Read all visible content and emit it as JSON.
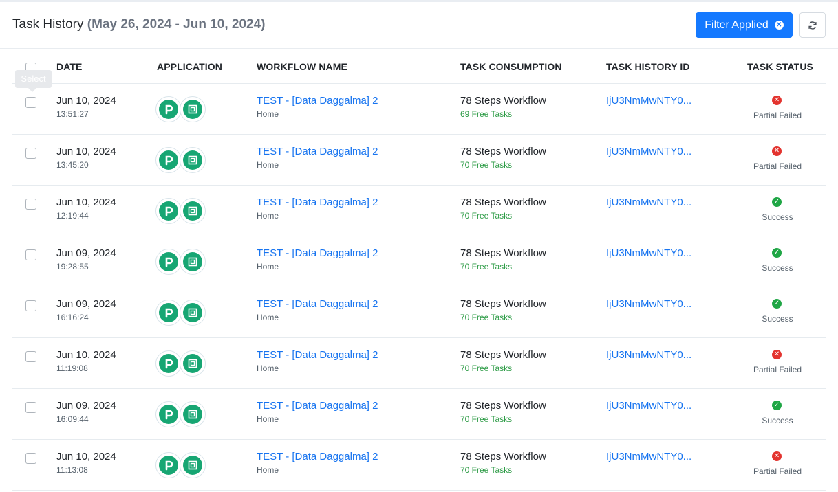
{
  "header": {
    "title": "Task History",
    "date_range": "(May 26, 2024 - Jun 10, 2024)",
    "filter_button": "Filter Applied",
    "filter_clear_icon": "close-circle-icon",
    "refresh_icon": "refresh-icon"
  },
  "table": {
    "select_tooltip": "Select",
    "columns": {
      "date": "DATE",
      "application": "APPLICATION",
      "workflow_name": "WORKFLOW NAME",
      "task_consumption": "TASK CONSUMPTION",
      "task_history_id": "TASK HISTORY ID",
      "task_status": "TASK STATUS"
    },
    "app_icons": [
      "pabbly-p-icon",
      "app-module-icon"
    ],
    "colors": {
      "accent": "#1479ff",
      "link": "#1774f0",
      "free_tasks": "#2c9b45",
      "failed": "#e3342f",
      "success": "#1fa645",
      "app_green": "#17a673"
    },
    "rows": [
      {
        "date": "Jun 10, 2024",
        "time": "13:51:27",
        "workflow": "TEST - [Data Daggalma] 2",
        "folder": "Home",
        "steps": "78 Steps Workflow",
        "free": "69 Free Tasks",
        "id": "IjU3NmMwNTY0...",
        "status": "Partial Failed",
        "status_type": "fail"
      },
      {
        "date": "Jun 10, 2024",
        "time": "13:45:20",
        "workflow": "TEST - [Data Daggalma] 2",
        "folder": "Home",
        "steps": "78 Steps Workflow",
        "free": "70 Free Tasks",
        "id": "IjU3NmMwNTY0...",
        "status": "Partial Failed",
        "status_type": "fail"
      },
      {
        "date": "Jun 10, 2024",
        "time": "12:19:44",
        "workflow": "TEST - [Data Daggalma] 2",
        "folder": "Home",
        "steps": "78 Steps Workflow",
        "free": "70 Free Tasks",
        "id": "IjU3NmMwNTY0...",
        "status": "Success",
        "status_type": "ok"
      },
      {
        "date": "Jun 09, 2024",
        "time": "19:28:55",
        "workflow": "TEST - [Data Daggalma] 2",
        "folder": "Home",
        "steps": "78 Steps Workflow",
        "free": "70 Free Tasks",
        "id": "IjU3NmMwNTY0...",
        "status": "Success",
        "status_type": "ok"
      },
      {
        "date": "Jun 09, 2024",
        "time": "16:16:24",
        "workflow": "TEST - [Data Daggalma] 2",
        "folder": "Home",
        "steps": "78 Steps Workflow",
        "free": "70 Free Tasks",
        "id": "IjU3NmMwNTY0...",
        "status": "Success",
        "status_type": "ok"
      },
      {
        "date": "Jun 10, 2024",
        "time": "11:19:08",
        "workflow": "TEST - [Data Daggalma] 2",
        "folder": "Home",
        "steps": "78 Steps Workflow",
        "free": "70 Free Tasks",
        "id": "IjU3NmMwNTY0...",
        "status": "Partial Failed",
        "status_type": "fail"
      },
      {
        "date": "Jun 09, 2024",
        "time": "16:09:44",
        "workflow": "TEST - [Data Daggalma] 2",
        "folder": "Home",
        "steps": "78 Steps Workflow",
        "free": "70 Free Tasks",
        "id": "IjU3NmMwNTY0...",
        "status": "Success",
        "status_type": "ok"
      },
      {
        "date": "Jun 10, 2024",
        "time": "11:13:08",
        "workflow": "TEST - [Data Daggalma] 2",
        "folder": "Home",
        "steps": "78 Steps Workflow",
        "free": "70 Free Tasks",
        "id": "IjU3NmMwNTY0...",
        "status": "Partial Failed",
        "status_type": "fail"
      }
    ]
  }
}
